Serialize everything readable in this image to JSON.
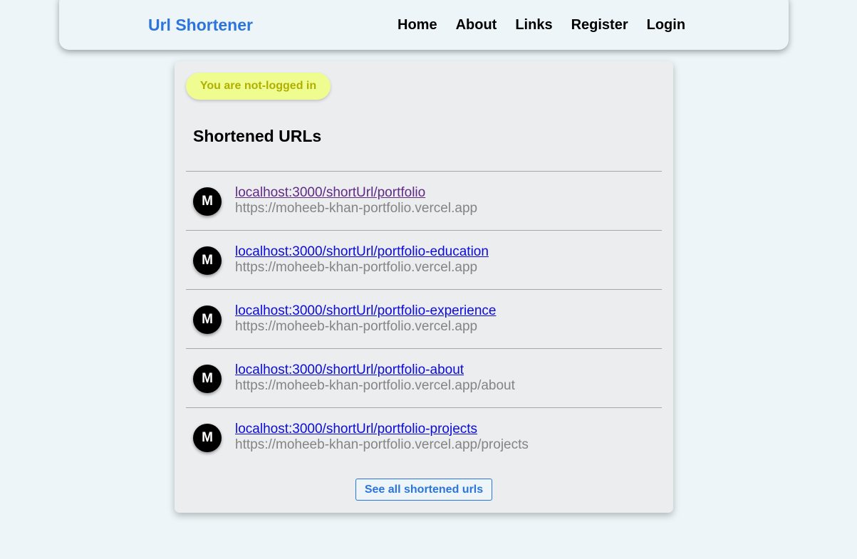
{
  "navbar": {
    "brand": "Url Shortener",
    "links": [
      {
        "label": "Home"
      },
      {
        "label": "About"
      },
      {
        "label": "Links"
      },
      {
        "label": "Register"
      },
      {
        "label": "Login"
      }
    ]
  },
  "status": {
    "text": "You are not-logged in",
    "color": "#b1af00",
    "background": "#eefc90"
  },
  "main": {
    "title": "Shortened URLs",
    "urls": [
      {
        "avatar": "M",
        "short": "localhost:3000/shortUrl/portfolio",
        "long": "https://moheeb-khan-portfolio.vercel.app",
        "visited": true
      },
      {
        "avatar": "M",
        "short": "localhost:3000/shortUrl/portfolio-education",
        "long": "https://moheeb-khan-portfolio.vercel.app",
        "visited": false
      },
      {
        "avatar": "M",
        "short": "localhost:3000/shortUrl/portfolio-experience",
        "long": "https://moheeb-khan-portfolio.vercel.app",
        "visited": false
      },
      {
        "avatar": "M",
        "short": "localhost:3000/shortUrl/portfolio-about",
        "long": "https://moheeb-khan-portfolio.vercel.app/about",
        "visited": false
      },
      {
        "avatar": "M",
        "short": "localhost:3000/shortUrl/portfolio-projects",
        "long": "https://moheeb-khan-portfolio.vercel.app/projects",
        "visited": false
      }
    ],
    "see_all_label": "See all shortened urls"
  },
  "colors": {
    "brand": "#2b74dc",
    "link": "#0b0bd9",
    "visited_link": "#5f2a85",
    "page_background": "#edf5f8"
  }
}
